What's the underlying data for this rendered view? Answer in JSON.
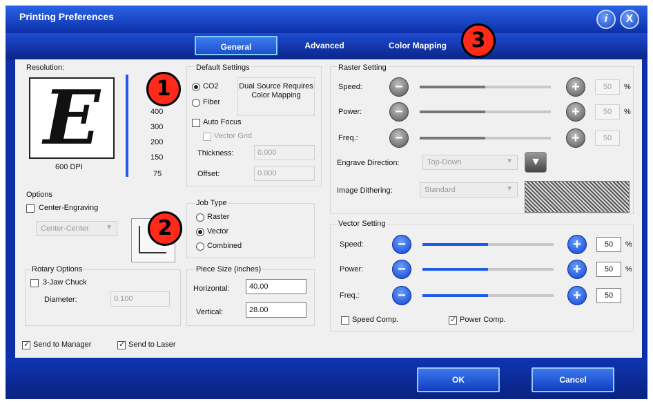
{
  "window": {
    "title": "Printing Preferences"
  },
  "header_buttons": {
    "info": "i",
    "close": "X"
  },
  "tabs": [
    {
      "label": "General",
      "active": true
    },
    {
      "label": "Advanced",
      "active": false
    },
    {
      "label": "Color Mapping",
      "active": false
    }
  ],
  "callouts": [
    "1",
    "2",
    "3"
  ],
  "resolution": {
    "label": "Resolution:",
    "preview_letter": "E",
    "dpi_label": "600 DPI",
    "ticks": [
      "400",
      "300",
      "200",
      "150",
      "75"
    ],
    "selected_fraction": 1.0
  },
  "default_settings": {
    "label": "Default Settings",
    "co2": "CO2",
    "fiber": "Fiber",
    "selected": "CO2",
    "note": "Dual Source Requires Color Mapping",
    "auto_focus": "Auto Focus",
    "auto_focus_checked": false,
    "vector_grid": "Vector Grid",
    "vector_grid_checked": false,
    "thickness_label": "Thickness:",
    "thickness_value": "0.000",
    "offset_label": "Offset:",
    "offset_value": "0.000"
  },
  "options": {
    "label": "Options",
    "center_engraving": "Center-Engraving",
    "center_engraving_checked": false,
    "center_select": "Center-Center"
  },
  "job_type": {
    "label": "Job Type",
    "raster": "Raster",
    "vector": "Vector",
    "combined": "Combined",
    "selected": "Vector"
  },
  "rotary": {
    "label": "Rotary Options",
    "jaw_chuck": "3-Jaw Chuck",
    "jaw_chuck_checked": false,
    "diameter_label": "Diameter:",
    "diameter_value": "0.100"
  },
  "piece_size": {
    "label": "Piece Size (inches)",
    "horizontal_label": "Horizontal:",
    "horizontal_value": "40.00",
    "vertical_label": "Vertical:",
    "vertical_value": "28.00"
  },
  "raster": {
    "label": "Raster Setting",
    "speed_label": "Speed:",
    "speed_value": "50",
    "power_label": "Power:",
    "power_value": "50",
    "freq_label": "Freq.:",
    "freq_value": "50",
    "percent": "%",
    "engrave_direction_label": "Engrave Direction:",
    "engrave_direction_value": "Top-Down",
    "image_dithering_label": "Image Dithering:",
    "image_dithering_value": "Standard"
  },
  "vector": {
    "label": "Vector Setting",
    "speed_label": "Speed:",
    "speed_value": "50",
    "power_label": "Power:",
    "power_value": "50",
    "freq_label": "Freq.:",
    "freq_value": "50",
    "percent": "%",
    "speed_comp": "Speed Comp.",
    "speed_comp_checked": false,
    "power_comp": "Power Comp.",
    "power_comp_checked": true
  },
  "bottom": {
    "send_to_manager": "Send to Manager",
    "send_to_manager_checked": true,
    "send_to_laser": "Send to Laser",
    "send_to_laser_checked": true
  },
  "footer": {
    "ok": "OK",
    "cancel": "Cancel"
  },
  "symbols": {
    "minus": "−",
    "plus": "+",
    "down_arrow": "▼"
  },
  "colors": {
    "accent": "#0d2fa8",
    "slider_blue": "#1e5be8",
    "callout": "#ff2a1a"
  }
}
